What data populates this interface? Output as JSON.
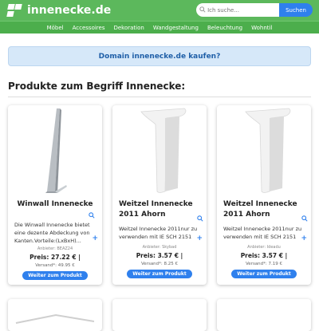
{
  "header": {
    "site_title": "innenecke.de",
    "search_placeholder": "Ich suche...",
    "search_button": "Suchen",
    "brand_color": "#5cb85c",
    "accent_color": "#2f80ed"
  },
  "nav": {
    "items": [
      "Möbel",
      "Accessoires",
      "Dekoration",
      "Wandgestaltung",
      "Beleuchtung",
      "Wohntil"
    ]
  },
  "banner": {
    "text": "Domain innenecke.de kaufen?"
  },
  "section": {
    "title": "Produkte zum Begriff Innenecke:"
  },
  "products": [
    {
      "title": "Winwall Innenecke",
      "description": "Die Winwall Innenecke bietet eine dezente Abdeckung von Kanten.Vorteile:(LxBxH)...",
      "seller": "Anbieter: BEAZ24",
      "price": "Preis: 27.22 € |",
      "shipping": "Versand*: 49.95 €",
      "button": "Weiter zum Produkt",
      "image_icon": "aluminium-corner-profile"
    },
    {
      "title": "Weitzel Innenecke 2011 Ahorn",
      "description": "Weitzel Innenecke 2011nur zu verwenden mit IE SCH 2151",
      "seller": "Anbieter: Skybad",
      "price": "Preis: 3.57 € |",
      "shipping": "Versand*: 8.25 €",
      "button": "Weiter zum Produkt",
      "image_icon": "white-corner-piece"
    },
    {
      "title": "Weitzel Innenecke 2011 Ahorn",
      "description": "Weitzel Innenecke 2011nur zu verwenden mit IE SCH 2151",
      "seller": "Anbieter: Ideadu",
      "price": "Preis: 3.57 € |",
      "shipping": "Versand*: 7.19 €",
      "button": "Weiter zum Produkt",
      "image_icon": "white-corner-piece"
    }
  ]
}
